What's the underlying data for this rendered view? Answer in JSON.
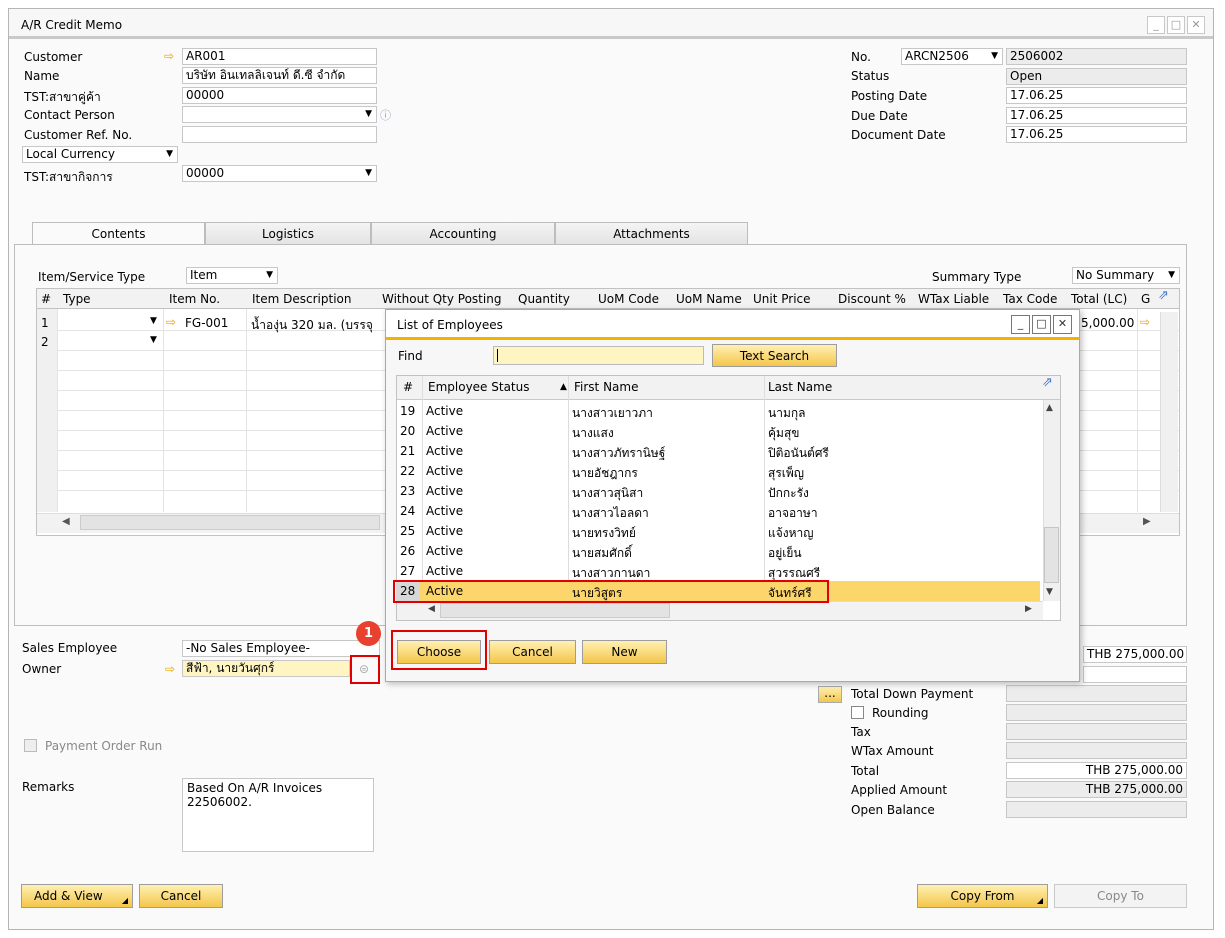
{
  "window": {
    "title": "A/R Credit Memo"
  },
  "header_left": {
    "customer_label": "Customer",
    "customer_value": "AR001",
    "name_label": "Name",
    "name_value": "บริษัท อินเทลลิเจนท์ ดี.ซี จำกัด",
    "tst_branch_label": "TST:สาขาคู่ค้า",
    "tst_branch_value": "00000",
    "contact_label": "Contact Person",
    "contact_value": "",
    "custref_label": "Customer Ref. No.",
    "custref_value": "",
    "currency_value": "Local Currency",
    "tst_biz_label": "TST:สาขากิจการ",
    "tst_biz_value": "00000"
  },
  "header_right": {
    "no_label": "No.",
    "series_value": "ARCN2506",
    "no_value": "2506002",
    "status_label": "Status",
    "status_value": "Open",
    "posting_label": "Posting Date",
    "posting_value": "17.06.25",
    "due_label": "Due Date",
    "due_value": "17.06.25",
    "doc_label": "Document Date",
    "doc_value": "17.06.25"
  },
  "tabs": [
    "Contents",
    "Logistics",
    "Accounting",
    "Attachments"
  ],
  "contents": {
    "item_type_label": "Item/Service Type",
    "item_type_value": "Item",
    "summary_label": "Summary Type",
    "summary_value": "No Summary",
    "columns": [
      "#",
      "Type",
      "Item No.",
      "Item Description",
      "Without Qty Posting",
      "Quantity",
      "UoM Code",
      "UoM Name",
      "Unit Price",
      "Discount %",
      "WTax Liable",
      "Tax Code",
      "Total (LC)",
      "G"
    ],
    "rows": [
      {
        "num": "1",
        "item_no": "FG-001",
        "desc": "น้ำองุ่น 320 มล. (บรรจุ",
        "total": "5,000.00"
      },
      {
        "num": "2",
        "item_no": "",
        "desc": "",
        "total": ""
      }
    ]
  },
  "footer_left": {
    "sales_emp_label": "Sales Employee",
    "sales_emp_value": "-No Sales Employee-",
    "owner_label": "Owner",
    "owner_value": "สีฟ้า, นายวันศุกร์",
    "payment_order_label": "Payment Order Run",
    "remarks_label": "Remarks",
    "remarks_value": "Based On A/R Invoices 22506002."
  },
  "footer_right": {
    "total_before_value": "THB 275,000.00",
    "down_payment_label": "Total Down Payment",
    "rounding_label": "Rounding",
    "tax_label": "Tax",
    "wtax_label": "WTax Amount",
    "total_label": "Total",
    "total_value": "THB 275,000.00",
    "applied_label": "Applied Amount",
    "applied_value": "THB 275,000.00",
    "open_balance_label": "Open Balance"
  },
  "buttons": {
    "add_view": "Add & View",
    "cancel": "Cancel",
    "copy_from": "Copy From",
    "copy_to": "Copy To"
  },
  "dialog": {
    "title": "List of Employees",
    "find_label": "Find",
    "find_value": "",
    "text_search": "Text Search",
    "columns": [
      "#",
      "Employee Status",
      "First Name",
      "Last Name"
    ],
    "rows": [
      {
        "num": "19",
        "status": "Active",
        "first": "นางสาวเยาวภา",
        "last": "นามกุล"
      },
      {
        "num": "20",
        "status": "Active",
        "first": "นางแสง",
        "last": "คุ้มสุข"
      },
      {
        "num": "21",
        "status": "Active",
        "first": "นางสาวภัทรานิษฐ์",
        "last": "ปิติอนันต์ศรี"
      },
      {
        "num": "22",
        "status": "Active",
        "first": "นายอัชฎากร",
        "last": "สุรเพ็ญ"
      },
      {
        "num": "23",
        "status": "Active",
        "first": "นางสาวสุนิสา",
        "last": "ปักกะรัง"
      },
      {
        "num": "24",
        "status": "Active",
        "first": "นางสาวไอลดา",
        "last": "อาจอาษา"
      },
      {
        "num": "25",
        "status": "Active",
        "first": "นายทรงวิทย์",
        "last": "แจ้งหาญ"
      },
      {
        "num": "26",
        "status": "Active",
        "first": "นายสมศักดิ์",
        "last": "อยู่เย็น"
      },
      {
        "num": "27",
        "status": "Active",
        "first": "นางสาวกานดา",
        "last": "สุวรรณศรี"
      },
      {
        "num": "28",
        "status": "Active",
        "first": "นายวิสูตร",
        "last": "จันทร์ศรี"
      }
    ],
    "choose": "Choose",
    "cancel": "Cancel",
    "new": "New"
  },
  "callout": {
    "number": "1"
  },
  "colors": {
    "accent": "#f0b400",
    "highlight_row": "#fcd56b",
    "button": "#f4c64b",
    "callout": "#e8412f"
  }
}
